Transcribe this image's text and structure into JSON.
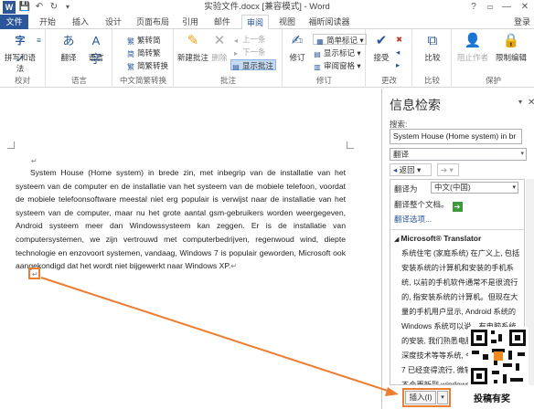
{
  "titlebar": {
    "title": "实验文件.docx [兼容模式] - Word",
    "help": "?",
    "minimize": "—",
    "restore": "❐",
    "close": "✕"
  },
  "tabs": [
    "文件",
    "开始",
    "插入",
    "设计",
    "页面布局",
    "引用",
    "邮件",
    "审阅",
    "视图",
    "福昕阅读器"
  ],
  "active_tab": "审阅",
  "login": "登录",
  "ribbon": {
    "proofing": {
      "label": "校对",
      "spelling": "拼写和语法",
      "thesaurus_icon": "thesaurus-icon"
    },
    "language": {
      "label": "语言",
      "translate": "翻译",
      "language": "语言"
    },
    "chinese_conversion": {
      "label": "中文简繁转换",
      "to_traditional": "繁转简",
      "to_simplified": "简转繁",
      "convert": "简繁转换"
    },
    "comments": {
      "label": "批注",
      "new": "新建批注",
      "delete": "删除",
      "prev": "上一条",
      "next": "下一条",
      "show": "显示批注"
    },
    "tracking": {
      "label": "修订",
      "track": "修订",
      "markup": "简单标记",
      "show_markup": "显示标记",
      "pane": "审阅窗格"
    },
    "changes": {
      "label": "更改",
      "accept": "接受"
    },
    "compare": {
      "label": "比较",
      "compare": "比较"
    },
    "protect": {
      "label": "保护",
      "block": "阻止作者",
      "restrict": "限制编辑"
    }
  },
  "document": {
    "paragraph": "System House (Home system) in brede zin, met inbegrip van de installatie van het systeem van de computer en de installatie van het systeem van de mobiele telefoon, voordat de mobiele telefoonsoftware meestal niet erg populair is verwijst naar de installatie van het systeem van de computer, maar nu het grote aantal gsm-gebruikers worden weergegeven, Android systeem meer dan Windowssysteem kan zeggen. Er is de installatie van computersystemen, we zijn vertrouwd met computerbedrijven, regenwoud wind, diepte technologie en enzovoort systemen, vandaag, Windows 7 is populair geworden, Microsoft ook aangekondigd dat het wordt niet bijgewerkt naar Windows XP.",
    "para_mark": "↵",
    "empty_mark": "↵"
  },
  "pane": {
    "title": "信息检索",
    "search_label": "搜索:",
    "search_value": "System House (Home system) in br",
    "service": "翻译",
    "back": "返回",
    "translate_to_label": "翻译为",
    "translate_to_value": "中文(中国)",
    "translate_doc": "翻译整个文档。",
    "translate_options": "翻译选项...",
    "provider": "Microsoft® Translator",
    "result_text": "系统住宅 (家庭系统) 在广义上, 包括安装系统的计算机和安装的手机系统, 以前的手机软件通常不是很流行的, 指安装系统的计算机。但现在大量的手机用户显示, Android 系统的 Windows 系统可以说。有电脑系统的安装, 我们熟悉电脑公司, 雨林风, 深度技术等等系统, 今天, Windows 7 已经变得流行, 微软也宣布, 它将不会更新到 windows XP。",
    "insert": "插入(I)"
  },
  "watermark": {
    "caption": "投稿有奖"
  },
  "colors": {
    "accent": "#2b579a",
    "highlight": "#ed7d31",
    "file_tab": "#2b579a"
  }
}
